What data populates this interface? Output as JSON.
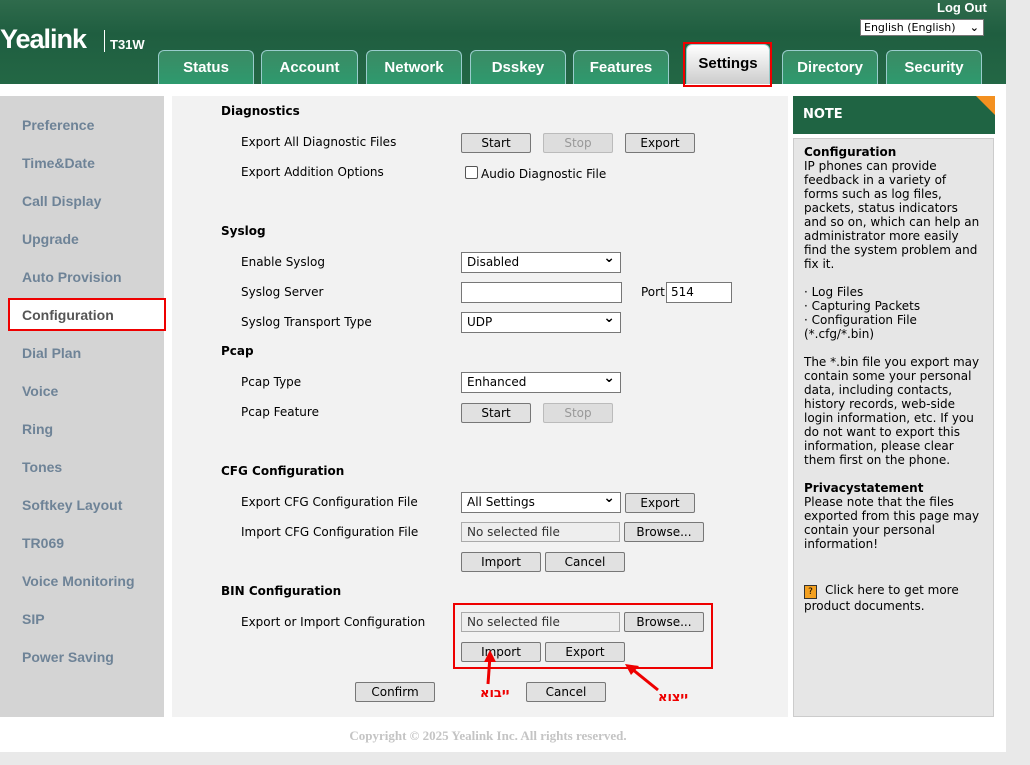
{
  "header": {
    "logo": "Yealink",
    "model": "T31W",
    "logout": "Log Out",
    "language": "English (English)"
  },
  "tabs": [
    {
      "label": "Status"
    },
    {
      "label": "Account"
    },
    {
      "label": "Network"
    },
    {
      "label": "Dsskey"
    },
    {
      "label": "Features"
    },
    {
      "label": "Settings",
      "active": true
    },
    {
      "label": "Directory"
    },
    {
      "label": "Security"
    }
  ],
  "sidebar": {
    "items": [
      "Preference",
      "Time&Date",
      "Call Display",
      "Upgrade",
      "Auto Provision",
      "Configuration",
      "Dial Plan",
      "Voice",
      "Ring",
      "Tones",
      "Softkey Layout",
      "TR069",
      "Voice Monitoring",
      "SIP",
      "Power Saving"
    ],
    "selected": "Configuration"
  },
  "diagnostics": {
    "title": "Diagnostics",
    "export_all": "Export All Diagnostic Files",
    "start": "Start",
    "stop": "Stop",
    "export": "Export",
    "addition": "Export Addition Options",
    "audio": "Audio Diagnostic File",
    "audio_checked": false
  },
  "syslog": {
    "title": "Syslog",
    "enable_label": "Enable Syslog",
    "enable_value": "Disabled",
    "server_label": "Syslog Server",
    "server_value": "",
    "port_label": "Port",
    "port_value": "514",
    "transport_label": "Syslog Transport Type",
    "transport_value": "UDP"
  },
  "pcap": {
    "title": "Pcap",
    "type_label": "Pcap Type",
    "type_value": "Enhanced",
    "feature_label": "Pcap Feature",
    "start": "Start",
    "stop": "Stop"
  },
  "cfg": {
    "title": "CFG Configuration",
    "export_label": "Export CFG Configuration File",
    "export_value": "All Settings",
    "export": "Export",
    "import_label": "Import CFG Configuration File",
    "file": "No selected file",
    "browse": "Browse...",
    "import": "Import",
    "cancel": "Cancel"
  },
  "bin": {
    "title": "BIN Configuration",
    "label": "Export or Import Configuration",
    "file": "No selected file",
    "browse": "Browse...",
    "import": "Import",
    "export": "Export"
  },
  "footer_buttons": {
    "confirm": "Confirm",
    "cancel": "Cancel"
  },
  "annotations": {
    "import": "ייבוא",
    "export": "ייצוא",
    "color": "#e00000"
  },
  "note": {
    "title": "NOTE",
    "h1": "Configuration",
    "p1": "IP phones can provide feedback in a variety of forms such as log files, packets, status indicators and so on, which can help an administrator more easily find the system problem and fix it.",
    "list": [
      "· Log Files",
      "· Capturing Packets",
      "· Configuration File (*.cfg/*.bin)"
    ],
    "p2": "The *.bin file you export may contain some your personal data, including contacts, history records, web-side login information, etc. If you do not want to export this information, please clear them first on the phone.",
    "h2": "Privacystatement",
    "p3": "Please note that the files exported from this page may contain your personal information!",
    "link": "Click here to get more product documents."
  },
  "copyright": "Copyright © 2025 Yealink Inc. All rights reserved.",
  "colors": {
    "header": "#1f6443",
    "accent": "#f39020",
    "sidebar_text": "#6e8397"
  }
}
